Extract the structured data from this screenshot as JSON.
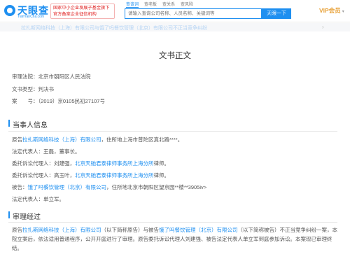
{
  "header": {
    "logo_name": "天眼查",
    "logo_sub": "TianYanCha.com",
    "badge_line1": "国家中小企业发展子基金旗下",
    "badge_line2": "官方备案企业征信机构",
    "search_tabs": [
      "查该词",
      "查老板",
      "查关系",
      "查风险"
    ],
    "search_placeholder": "请输入查询公司名称、人员名称、关键词等",
    "search_button": "天眼一下",
    "vip_label": "VIP会员"
  },
  "faded_bar": {
    "text": "拉扎斯网络科技（上海）有限公司与饿了吗餐饮管理（北京）有限公司不正当竞争纠纷"
  },
  "document": {
    "title": "文书正文",
    "court_label": "审理法院：",
    "court_value": "北京市朝阳区人民法院",
    "type_label": "文书类型：",
    "type_value": "判决书",
    "case_label": "案　　号：",
    "case_value": "（2019）京0105民初27107号"
  },
  "parties": {
    "section_title": "当事人信息",
    "plaintiff_prefix": "原告",
    "plaintiff_name": "拉扎斯网络科技（上海）有限公司",
    "plaintiff_suffix": "，住所地上海市普陀区真北路****。",
    "legal_rep": "法定代表人：王磊，董事长。",
    "agent1_prefix": "委托诉讼代理人：刘建强，",
    "agent1_firm": "北京天驰君泰律师事务所上海分所",
    "agent1_suffix": "律师。",
    "agent2_prefix": "委托诉讼代理人：高玉叶，",
    "agent2_firm": "北京天驰君泰律师事务所上海分所",
    "agent2_suffix": "律师。",
    "defendant_prefix": "被告：",
    "defendant_name": "饿了吗餐饮管理（北京）有限公司",
    "defendant_suffix": "，住所地北京市朝阳区望京园**楼**3905iv>",
    "defendant_legal_rep": "法定代表人：单立军。"
  },
  "trial": {
    "section_title": "审理经过",
    "p1_prefix": "原告",
    "p1_plaintiff": "拉扎斯网络科技（上海）有限公司",
    "p1_mid": "（以下简称原告）与被告",
    "p1_defendant": "饿了吗餐饮管理（北京）有限公司",
    "p1_rest": "（以下简称被告）不正当竞争纠纷一案，本院立案后，依法适用普通程序，公开开庭进行了审理。原告委托诉讼代理人刘建强、被告法定代表人单立军到庭参加诉讼。本案现已审理终结。"
  }
}
